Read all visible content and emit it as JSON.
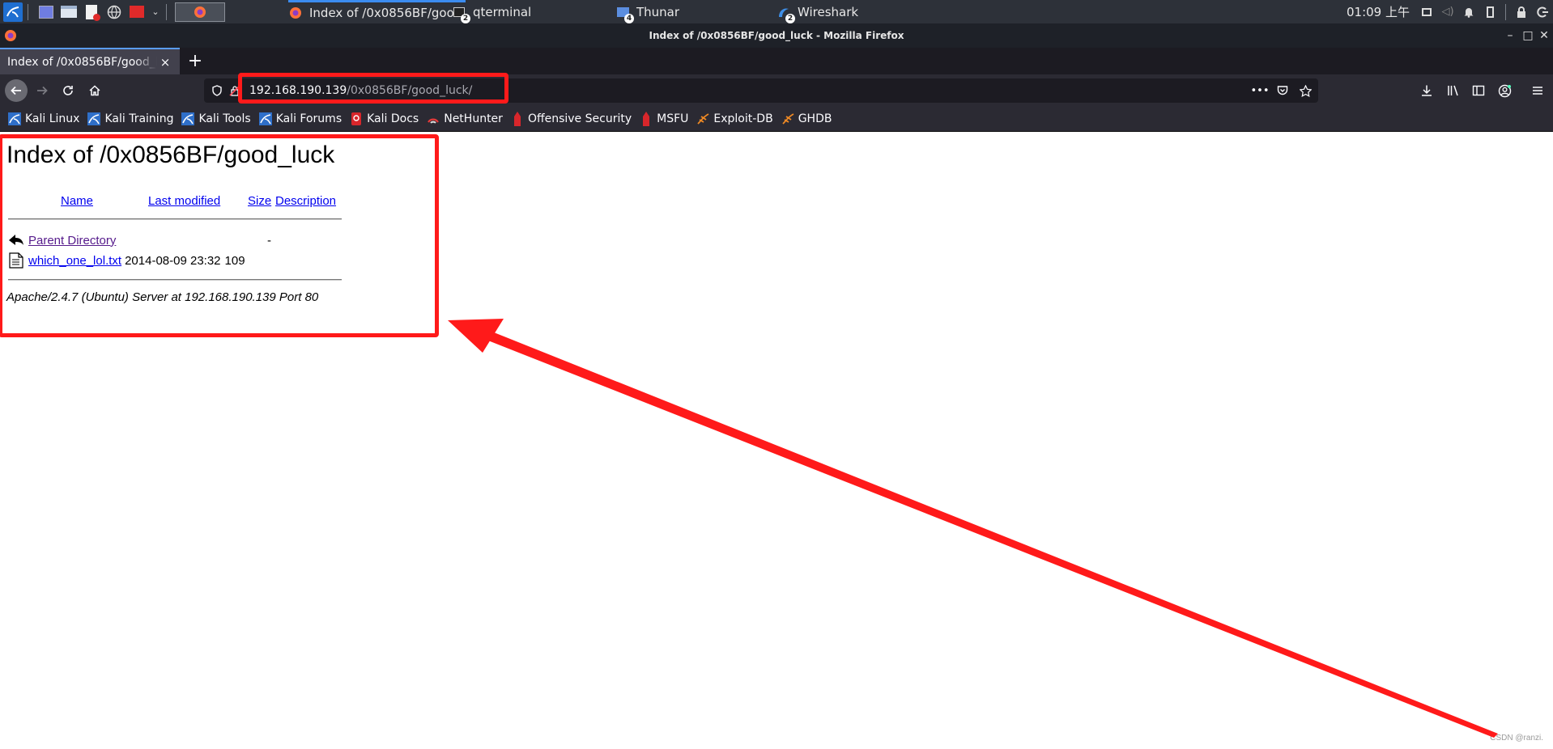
{
  "taskbar": {
    "tasks": [
      {
        "label": "Index of /0x0856BF/goo...",
        "icon": "firefox-icon",
        "badge": ""
      },
      {
        "label": "qterminal",
        "icon": "terminal-icon",
        "badge": "2"
      },
      {
        "label": "Thunar",
        "icon": "folder-icon",
        "badge": "4"
      },
      {
        "label": "Wireshark",
        "icon": "wireshark-icon",
        "badge": "2"
      }
    ],
    "clock": "01:09 上午"
  },
  "window": {
    "title": "Index of /0x0856BF/good_luck - Mozilla Firefox"
  },
  "tab": {
    "label": "Index of /0x0856BF/good_luck",
    "close": "×",
    "new": "+"
  },
  "urlbar": {
    "host": "192.168.190.139",
    "path": "/0x0856BF/good_luck/"
  },
  "bookmarks": [
    {
      "label": "Kali Linux",
      "icon": "kali-icon"
    },
    {
      "label": "Kali Training",
      "icon": "kali-icon"
    },
    {
      "label": "Kali Tools",
      "icon": "kali-icon"
    },
    {
      "label": "Kali Forums",
      "icon": "kali-icon"
    },
    {
      "label": "Kali Docs",
      "icon": "docs-icon"
    },
    {
      "label": "NetHunter",
      "icon": "nethunter-icon"
    },
    {
      "label": "Offensive Security",
      "icon": "offsec-icon"
    },
    {
      "label": "MSFU",
      "icon": "msfu-icon"
    },
    {
      "label": "Exploit-DB",
      "icon": "exploitdb-icon"
    },
    {
      "label": "GHDB",
      "icon": "ghdb-icon"
    }
  ],
  "page": {
    "title": "Index of /0x0856BF/good_luck",
    "columns": {
      "name": "Name",
      "modified": "Last modified",
      "size": "Size",
      "description": "Description"
    },
    "rows": [
      {
        "name": "Parent Directory",
        "modified": "",
        "size": "-"
      },
      {
        "name": "which_one_lol.txt",
        "modified": "2014-08-09 23:32",
        "size": "109"
      }
    ],
    "address": "Apache/2.4.7 (Ubuntu) Server at 192.168.190.139 Port 80"
  },
  "watermark": "CSDN @ranzi.",
  "colors": {
    "annotation": "#ff1a1a",
    "link": "#0000ee",
    "visited_link": "#551a8b"
  }
}
